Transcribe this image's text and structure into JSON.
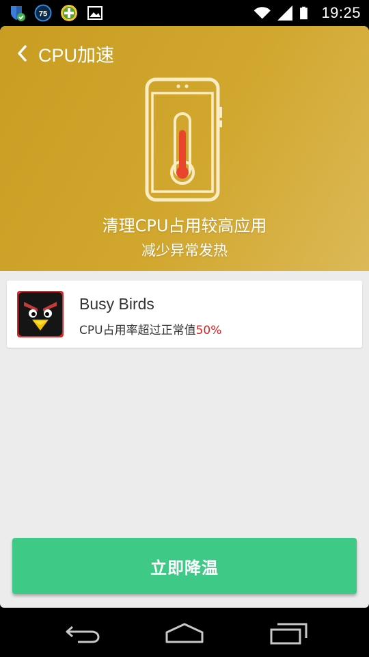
{
  "status_bar": {
    "time": "19:25",
    "left_icons": [
      "shield-check-icon",
      "badge-75-icon",
      "green-plus-icon",
      "image-icon"
    ],
    "badge_number": "75",
    "right_icons": [
      "wifi-icon",
      "signal-icon",
      "battery-icon"
    ]
  },
  "header": {
    "title": "CPU加速",
    "back_icon": "chevron-left-icon",
    "hero_icon": "phone-thermometer-icon",
    "headline": "清理CPU占用较高应用",
    "subheadline": "减少异常发热",
    "background_color": "#cfa42b"
  },
  "app_list": [
    {
      "name": "Busy Birds",
      "icon": "angry-bird-icon",
      "desc_prefix": "CPU占用率超过正常值",
      "desc_percent": "50%"
    }
  ],
  "actions": {
    "cool_down_label": "立即降温",
    "cool_down_color": "#3ec986"
  },
  "nav_bar": {
    "icons": [
      "back-arrow-icon",
      "home-icon",
      "recent-apps-icon"
    ]
  },
  "colors": {
    "accent_red": "#e02020",
    "background": "#ececec"
  }
}
